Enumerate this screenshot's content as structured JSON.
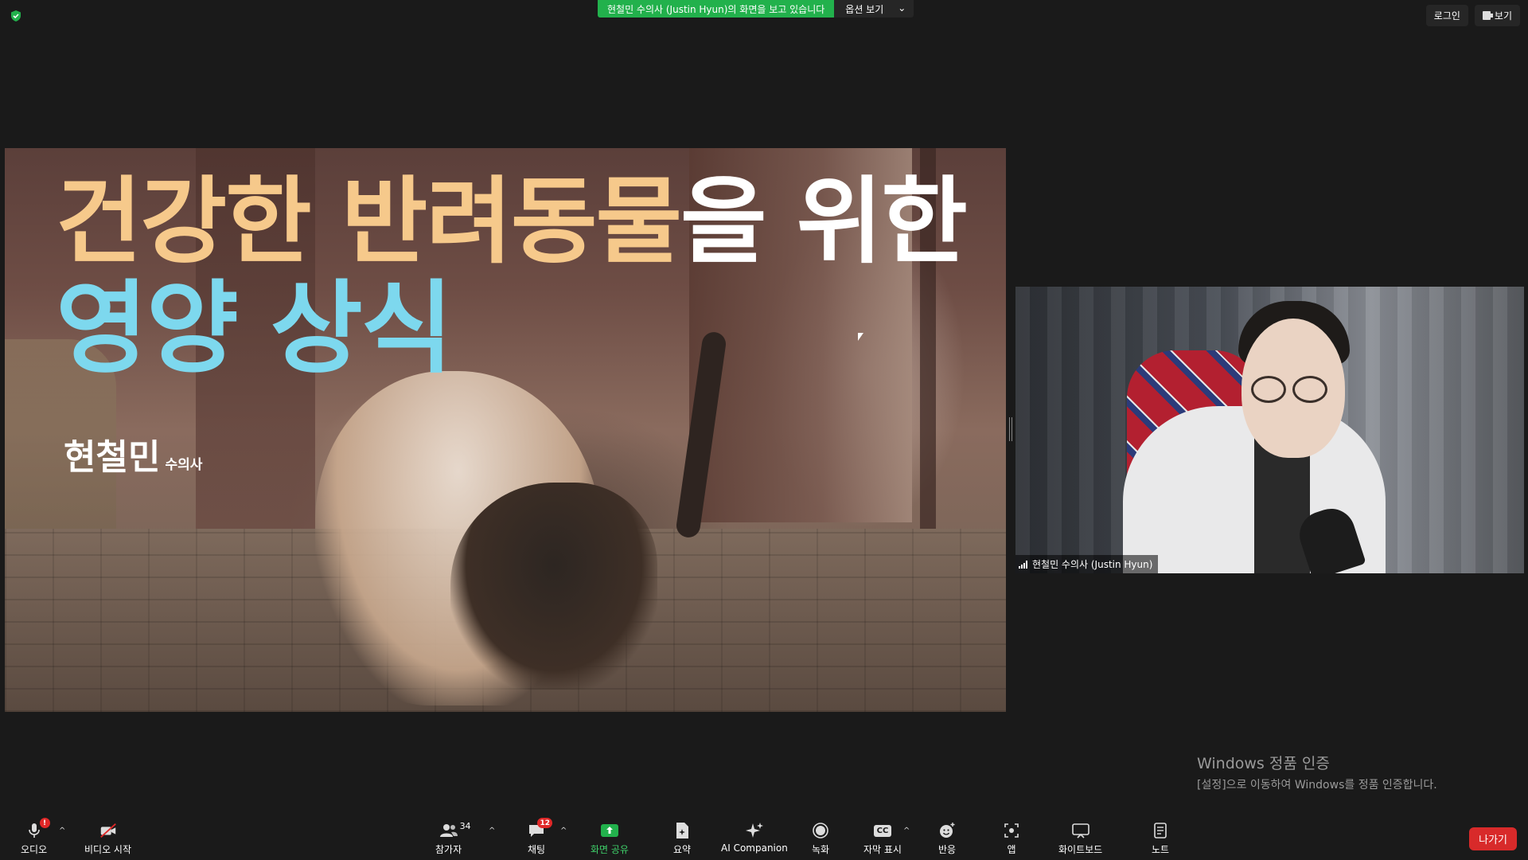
{
  "topbar": {
    "share_message": "현철민 수의사 (Justin Hyun)의 화면을 보고 있습니다",
    "view_options_label": "옵션 보기",
    "login_label": "로그인",
    "view_label": "보기"
  },
  "slide": {
    "title_line1_accent": "건강한 반려동물",
    "title_line1_rest": "을 위한",
    "title_line2": "영양 상식",
    "presenter_name": "현철민",
    "presenter_role": "수의사"
  },
  "video": {
    "participant_name": "현철민 수의사 (Justin Hyun)"
  },
  "watermark": {
    "line1": "Windows 정품 인증",
    "line2": "[설정]으로 이동하여 Windows를 정품 인증합니다."
  },
  "toolbar": {
    "audio_label": "오디오",
    "audio_badge": "!",
    "video_label": "비디오 시작",
    "participants_label": "참가자",
    "participants_count": "34",
    "chat_label": "채팅",
    "chat_badge": "12",
    "share_label": "화면 공유",
    "summary_label": "요약",
    "ai_label": "AI Companion",
    "record_label": "녹화",
    "captions_label": "자막 표시",
    "captions_icon_text": "CC",
    "reactions_label": "반응",
    "apps_label": "앱",
    "whiteboard_label": "화이트보드",
    "notes_label": "노트",
    "leave_label": "나가기"
  },
  "colors": {
    "share_banner": "#22b14c",
    "title_accent": "#f6c98b",
    "title_blue": "#7dd8ee",
    "leave_button": "#d82a2a"
  }
}
